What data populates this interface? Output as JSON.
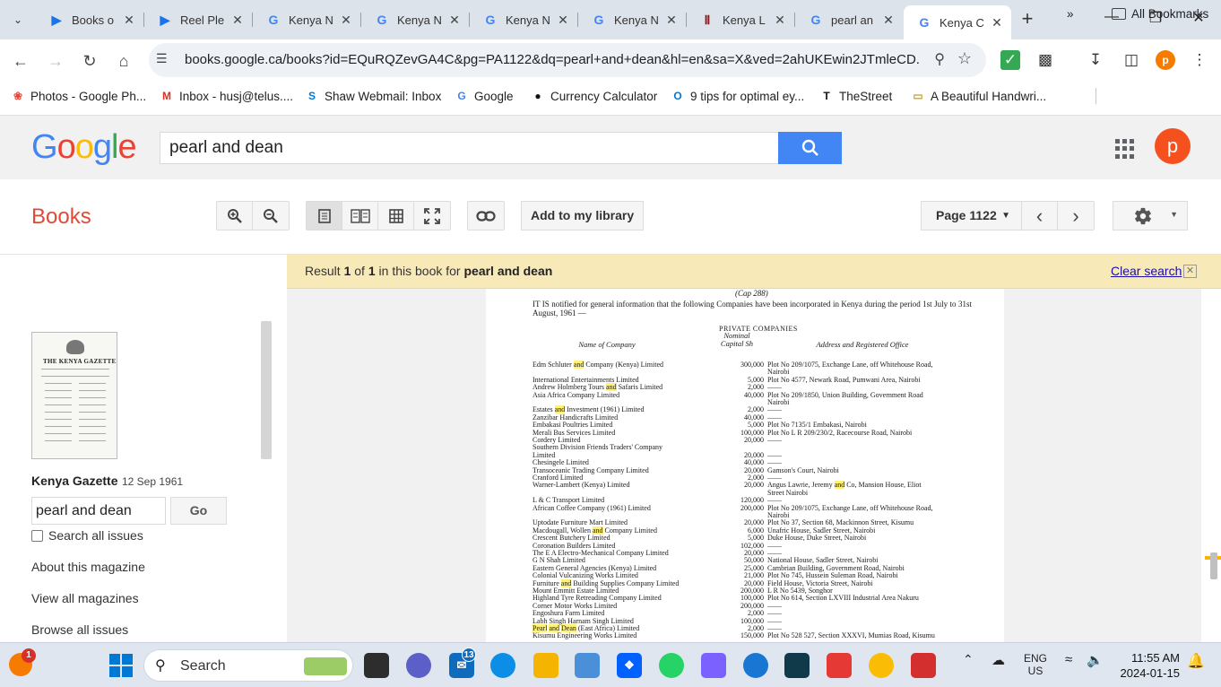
{
  "browser": {
    "tabs": [
      {
        "title": "Books o",
        "favicon": "play-books-icon",
        "color": "#1a73e8"
      },
      {
        "title": "Reel Ple",
        "favicon": "play-books-icon",
        "color": "#1a73e8"
      },
      {
        "title": "Kenya N",
        "favicon": "google-icon",
        "color": "#4285f4"
      },
      {
        "title": "Kenya N",
        "favicon": "google-icon",
        "color": "#4285f4"
      },
      {
        "title": "Kenya N",
        "favicon": "google-icon",
        "color": "#4285f4"
      },
      {
        "title": "Kenya N",
        "favicon": "google-icon",
        "color": "#4285f4"
      },
      {
        "title": "Kenya L",
        "favicon": "library-icon",
        "color": "#8b1a1a"
      },
      {
        "title": "pearl an",
        "favicon": "google-icon",
        "color": "#4285f4"
      },
      {
        "title": "Kenya C",
        "favicon": "google-icon",
        "color": "#4285f4"
      }
    ],
    "url": "books.google.ca/books?id=EQuRQZevGA4C&pg=PA1122&dq=pearl+and+dean&hl=en&sa=X&ved=2ahUKEwin2JTmleCD...",
    "profile_initial": "p",
    "bookmarks": [
      {
        "label": "Photos - Google Ph...",
        "icon": "photos-icon"
      },
      {
        "label": "Inbox - husj@telus....",
        "icon": "gmail-icon"
      },
      {
        "label": "Shaw Webmail: Inbox",
        "icon": "shaw-icon"
      },
      {
        "label": "Google",
        "icon": "google-icon"
      },
      {
        "label": "Currency Calculator",
        "icon": "currency-icon"
      },
      {
        "label": "9 tips for optimal ey...",
        "icon": "outlook-icon"
      },
      {
        "label": "TheStreet",
        "icon": "thestreet-icon"
      },
      {
        "label": "A Beautiful Handwri...",
        "icon": "folder-icon"
      }
    ],
    "all_bookmarks": "All Bookmarks",
    "more_bookmarks": "»"
  },
  "google": {
    "logo": [
      "G",
      "o",
      "o",
      "g",
      "l",
      "e"
    ],
    "logo_colors": [
      "#4285f4",
      "#ea4335",
      "#fbbc05",
      "#4285f4",
      "#34a853",
      "#ea4335"
    ],
    "search_value": "pearl and dean",
    "avatar_initial": "p"
  },
  "books": {
    "section_title": "Books",
    "add_library": "Add to my library",
    "page_select": "Page 1122"
  },
  "sidebar": {
    "thumb_masthead": "THE KENYA GAZETTE",
    "magazine_title": "Kenya Gazette",
    "magazine_date": "12 Sep 1961",
    "search_value": "pearl and dean",
    "go_label": "Go",
    "search_all": "Search all issues",
    "links": [
      "About this magazine",
      "View all magazines",
      "Browse all issues"
    ]
  },
  "result": {
    "prefix": "Result",
    "index": "1",
    "of": "of",
    "total": "1",
    "mid": "in this book for",
    "query": "pearl and dean",
    "clear": "Clear search"
  },
  "page_scan": {
    "cap": "(Cap 288)",
    "intro": "IT IS notified for general information that the following Companies have been incorporated in Kenya during the period 1st July to 31st August, 1961 —",
    "heading": "PRIVATE COMPANIES",
    "col_name": "Name of Company",
    "col_capital": "Nominal Capital Sh",
    "col_address": "Address and Registered Office",
    "rows": [
      {
        "name": "Edm Schluter and Company (Kenya) Limited",
        "capital": "300,000",
        "address": "Plot No 209/1075, Exchange Lane, off Whitehouse Road,"
      },
      {
        "name": "",
        "capital": "",
        "address": "Nairobi"
      },
      {
        "name": "International Entertainments Limited",
        "capital": "5,000",
        "address": "Plot No 4577, Newark Road, Pumwani Area, Nairobi"
      },
      {
        "name": "Andrew Holmberg Tours and Safaris Limited",
        "capital": "2,000",
        "address": "——"
      },
      {
        "name": "Asia Africa Company Limited",
        "capital": "40,000",
        "address": "Plot No 209/1850, Union Building, Government Road"
      },
      {
        "name": "",
        "capital": "",
        "address": "Nairobi"
      },
      {
        "name": "Estates and Investment (1961) Limited",
        "capital": "2,000",
        "address": "——"
      },
      {
        "name": "Zanzibar Handicrafts Limited",
        "capital": "40,000",
        "address": "——"
      },
      {
        "name": "Embakasi Poultries Limited",
        "capital": "5,000",
        "address": "Plot No 7135/1 Embakasi, Nairobi"
      },
      {
        "name": "Merali Bus Services Limited",
        "capital": "100,000",
        "address": "Plot No L R 209/230/2, Racecourse Road, Nairobi"
      },
      {
        "name": "Cordery Limited",
        "capital": "20,000",
        "address": "——"
      },
      {
        "name": "Southern Division Friends Traders' Company",
        "capital": "",
        "address": ""
      },
      {
        "name": "  Limited",
        "capital": "20,000",
        "address": "——"
      },
      {
        "name": "Chesingele Limited",
        "capital": "40,000",
        "address": "——"
      },
      {
        "name": "Transoceanic Trading Company Limited",
        "capital": "20,000",
        "address": "Gamson's Court, Nairobi"
      },
      {
        "name": "Cranford Limited",
        "capital": "2,000",
        "address": "——"
      },
      {
        "name": "Warner-Lambert (Kenya) Limited",
        "capital": "20,000",
        "address": "Angus Lawrie, Jeremy and Co, Mansion House, Eliot"
      },
      {
        "name": "",
        "capital": "",
        "address": "  Street Nairobi"
      },
      {
        "name": "L & C Transport Limited",
        "capital": "120,000",
        "address": "——"
      },
      {
        "name": "African Coffee Company (1961) Limited",
        "capital": "200,000",
        "address": "Plot No 209/1075, Exchange Lane, off Whitehouse Road,"
      },
      {
        "name": "",
        "capital": "",
        "address": "Nairobi"
      },
      {
        "name": "Uptodate Furniture Mart Limited",
        "capital": "20,000",
        "address": "Plot No 37, Section 68, Mackinnon Street, Kisumu"
      },
      {
        "name": "Macdougall, Wollen and Company Limited",
        "capital": "6,000",
        "address": "Unafric House, Sadler Street, Nairobi"
      },
      {
        "name": "Crescent Butchery Limited",
        "capital": "5,000",
        "address": "Duke House, Duke Street, Nairobi"
      },
      {
        "name": "Coronation Builders Limited",
        "capital": "102,000",
        "address": "——"
      },
      {
        "name": "The E A Electro-Mechanical Company Limited",
        "capital": "20,000",
        "address": "——"
      },
      {
        "name": "G N Shah Limited",
        "capital": "50,000",
        "address": "National House, Sadler Street, Nairobi"
      },
      {
        "name": "Eastern General Agencies (Kenya) Limited",
        "capital": "25,000",
        "address": "Cambrian Building, Government Road, Nairobi"
      },
      {
        "name": "Colonial Vulcanizing Works Limited",
        "capital": "21,000",
        "address": "Plot No 745, Hussein Suleman Road, Nairobi"
      },
      {
        "name": "Furniture and Building Supplies Company Limited",
        "capital": "20,000",
        "address": "Field House, Victoria Street, Nairobi"
      },
      {
        "name": "Mount Emmitt Estate Limited",
        "capital": "200,000",
        "address": "L R No 5439, Songhor"
      },
      {
        "name": "Highland Tyre Retreading Company Limited",
        "capital": "100,000",
        "address": "Plot No 614, Section LXVIII Industrial Area Nakuru"
      },
      {
        "name": "Corner Motor Works Limited",
        "capital": "200,000",
        "address": "——"
      },
      {
        "name": "Engoshura Farm Limited",
        "capital": "2,000",
        "address": "——"
      },
      {
        "name": "Labh Singh Harnam Singh Limited",
        "capital": "100,000",
        "address": "——"
      },
      {
        "name": "Pearl and Dean (East Africa) Limited",
        "capital": "2,000",
        "address": "——"
      },
      {
        "name": "Kisumu Engineering Works Limited",
        "capital": "150,000",
        "address": "Plot No 528 527, Section XXXVI, Mumias Road, Kisumu"
      }
    ]
  },
  "taskbar": {
    "notification_count": "1",
    "mail_count": "13",
    "search_label": "Search",
    "lang_top": "ENG",
    "lang_bottom": "US",
    "time": "11:55 AM",
    "date": "2024-01-15"
  }
}
